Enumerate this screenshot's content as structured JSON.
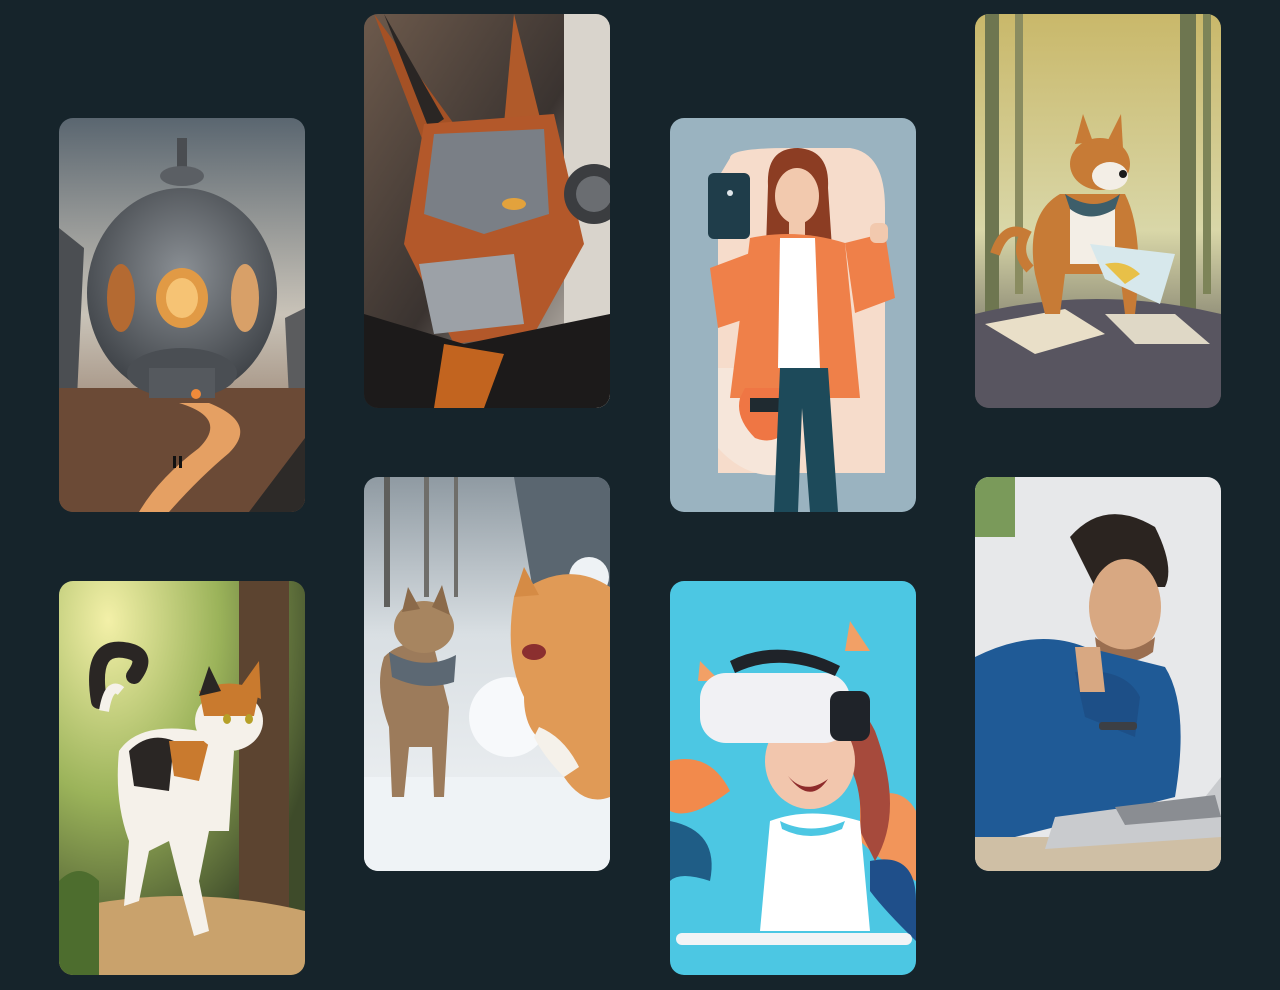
{
  "gallery": {
    "items": [
      {
        "icon": "sci-fi-dome-building-image"
      },
      {
        "icon": "robot-fox-mask-image"
      },
      {
        "icon": "woman-holding-phone-illustration"
      },
      {
        "icon": "dog-with-map-in-forest-illustration"
      },
      {
        "icon": "calico-cat-walking-image"
      },
      {
        "icon": "two-cats-snowball-image"
      },
      {
        "icon": "woman-vr-headset-illustration"
      },
      {
        "icon": "man-thinking-at-laptop-image"
      }
    ]
  },
  "colors": {
    "background": "#16242b"
  }
}
